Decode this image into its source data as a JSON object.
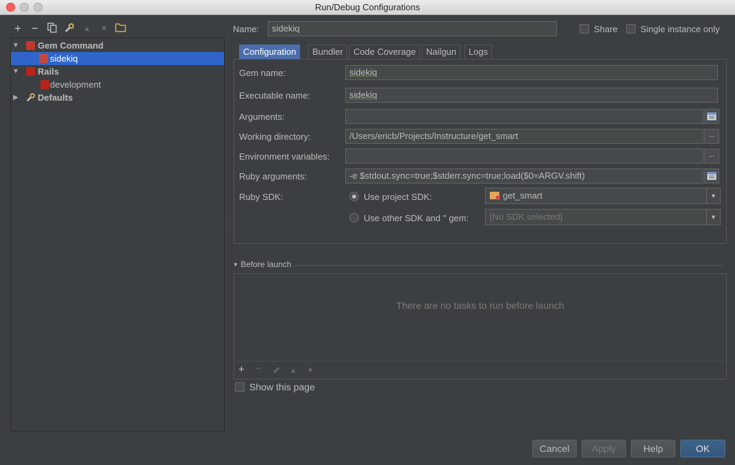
{
  "window": {
    "title": "Run/Debug Configurations"
  },
  "toolbar": {
    "items": [
      "add-icon",
      "remove-icon",
      "copy-icon",
      "wrench-icon",
      "move-up-icon",
      "move-down-icon",
      "folder-icon"
    ]
  },
  "tree": {
    "items": [
      {
        "label": "Gem Command",
        "kind": "group",
        "expanded": true
      },
      {
        "label": "sidekiq",
        "kind": "config",
        "selected": true
      },
      {
        "label": "Rails",
        "kind": "group",
        "expanded": true
      },
      {
        "label": "development",
        "kind": "config"
      },
      {
        "label": "Defaults",
        "kind": "group",
        "expanded": false
      }
    ]
  },
  "header": {
    "name_label": "Name:",
    "name_value": "sidekiq",
    "share_label": "Share",
    "single_instance_label": "Single instance only"
  },
  "tabs": [
    {
      "label": "Configuration",
      "active": true
    },
    {
      "label": "Bundler"
    },
    {
      "label": "Code Coverage"
    },
    {
      "label": "Nailgun"
    },
    {
      "label": "Logs"
    }
  ],
  "config": {
    "gem_name_label": "Gem name:",
    "gem_name_value": "sidekiq",
    "executable_label": "Executable name:",
    "executable_value": "sidekiq",
    "arguments_label": "Arguments:",
    "arguments_value": "",
    "working_dir_label": "Working directory:",
    "working_dir_value": "/Users/ericb/Projects/Instructure/get_smart",
    "env_label": "Environment variables:",
    "env_value": "",
    "ruby_args_label": "Ruby arguments:",
    "ruby_args_value": "-e $stdout.sync=true;$stderr.sync=true;load($0=ARGV.shift)",
    "ruby_sdk_label": "Ruby SDK:",
    "use_project_sdk_label": "Use project SDK:",
    "project_sdk_value": "get_smart",
    "use_other_sdk_label": "Use other SDK and '' gem:",
    "other_sdk_value": "[No SDK selected]",
    "ellipsis": "..."
  },
  "before_launch": {
    "header": "Before launch",
    "empty_text": "There are no tasks to run before launch",
    "show_page_label": "Show this page"
  },
  "buttons": {
    "cancel": "Cancel",
    "apply": "Apply",
    "help": "Help",
    "ok": "OK"
  },
  "colors": {
    "selection": "#2f65ca",
    "background": "#3b3f41",
    "active_tab": "#4b6eaf"
  }
}
